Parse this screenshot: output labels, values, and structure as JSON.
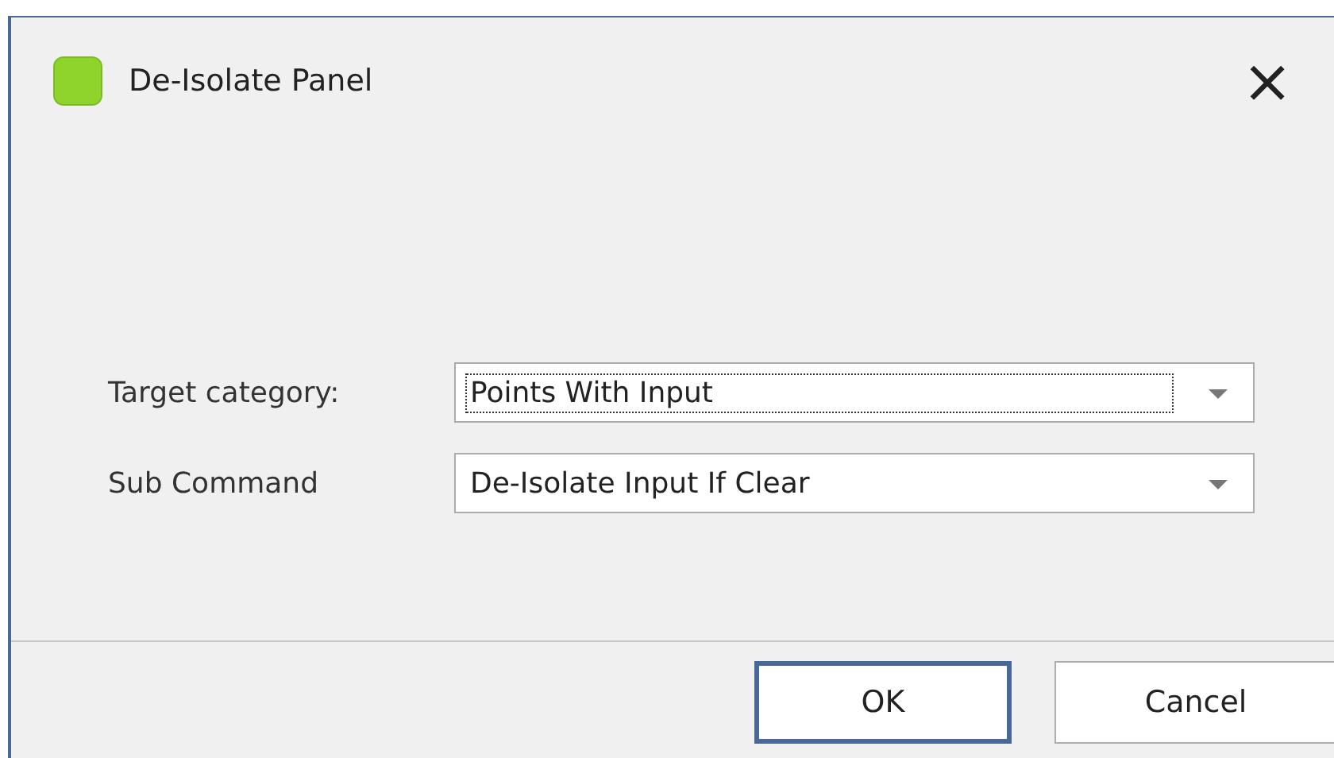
{
  "window": {
    "title": "De-Isolate Panel",
    "close": "×"
  },
  "fields": [
    {
      "label": "Target category:",
      "value": "Points With Input",
      "focused": true
    },
    {
      "label": "Sub Command",
      "value": "De-Isolate Input If Clear",
      "focused": false
    }
  ],
  "buttons": [
    {
      "label": "OK",
      "default": true
    },
    {
      "label": "Cancel",
      "default": false
    }
  ]
}
